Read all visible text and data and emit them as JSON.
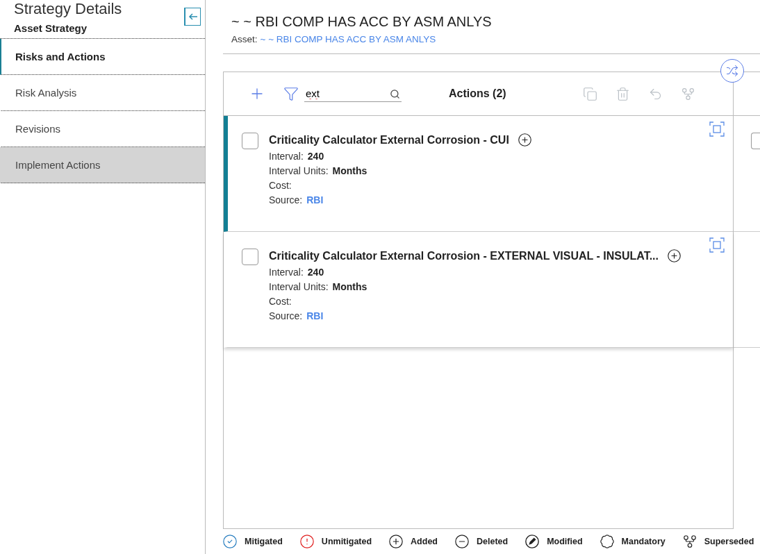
{
  "sidebar": {
    "title": "Strategy Details",
    "subtitle": "Asset Strategy",
    "items": [
      {
        "label": "Risks and Actions",
        "selected": true,
        "highlighted": false
      },
      {
        "label": "Risk Analysis",
        "selected": false,
        "highlighted": false
      },
      {
        "label": "Revisions",
        "selected": false,
        "highlighted": false
      },
      {
        "label": "Implement Actions",
        "selected": false,
        "highlighted": true
      }
    ]
  },
  "header": {
    "title": "~ ~ RBI COMP HAS ACC BY ASM ANLYS",
    "asset_label": "Asset:",
    "asset_link": "~ ~ RBI COMP HAS ACC BY ASM ANLYS"
  },
  "panel": {
    "search": {
      "value": "ext"
    },
    "title": "Actions (2)",
    "cards": [
      {
        "title": "Criticality Calculator External Corrosion - CUI",
        "selected": true,
        "checked": false,
        "fields": [
          {
            "label": "Interval:",
            "value": "240",
            "kind": "text"
          },
          {
            "label": "Interval Units:",
            "value": "Months",
            "kind": "text"
          },
          {
            "label": "Cost:"
          },
          {
            "label": "Source:",
            "value": "RBI",
            "kind": "link"
          }
        ]
      },
      {
        "title": "Criticality Calculator External Corrosion - EXTERNAL VISUAL - INSULAT...",
        "selected": false,
        "checked": false,
        "fields": [
          {
            "label": "Interval:",
            "value": "240",
            "kind": "text"
          },
          {
            "label": "Interval Units:",
            "value": "Months",
            "kind": "text"
          },
          {
            "label": "Cost:"
          },
          {
            "label": "Source:",
            "value": "RBI",
            "kind": "link"
          }
        ]
      }
    ]
  },
  "next_panel": {
    "cards": [
      {
        "checked": false
      }
    ]
  },
  "legend": [
    {
      "label": "Mitigated",
      "kind": "mitigated"
    },
    {
      "label": "Unmitigated",
      "kind": "unmitigated"
    },
    {
      "label": "Added",
      "kind": "added"
    },
    {
      "label": "Deleted",
      "kind": "deleted"
    },
    {
      "label": "Modified",
      "kind": "modified"
    },
    {
      "label": "Mandatory",
      "kind": "mandatory"
    },
    {
      "label": "Superseded",
      "kind": "superseded"
    }
  ]
}
